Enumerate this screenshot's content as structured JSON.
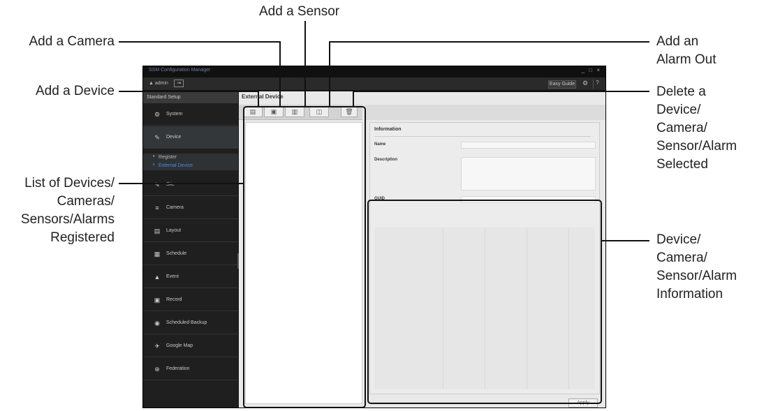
{
  "callouts": {
    "add_sensor": "Add a Sensor",
    "add_camera": "Add a Camera",
    "add_device": "Add a Device",
    "add_alarm_out_1": "Add an",
    "add_alarm_out_2": "Alarm Out",
    "delete_1": "Delete a",
    "delete_2": "Device/",
    "delete_3": "Camera/",
    "delete_4": "Sensor/Alarm",
    "delete_5": "Selected",
    "list_1": "List of Devices/",
    "list_2": "Cameras/",
    "list_3": "Sensors/Alarms",
    "list_4": "Registered",
    "info_1": "Device/",
    "info_2": "Camera/",
    "info_3": "Sensor/Alarm",
    "info_4": "Information"
  },
  "app": {
    "title": "SSM Configuration Manager",
    "window_controls": "_ □ ×",
    "user": "admin",
    "logout_glyph": "⇥",
    "easy_guide": "Easy Guide",
    "settings_icon": "gear-icon",
    "help": "?"
  },
  "sidebar": {
    "header": "Standard Setup",
    "items": [
      {
        "label": "System",
        "icon": "⚙"
      },
      {
        "label": "Device",
        "icon": "✎"
      },
      {
        "label": "Site",
        "icon": "✎"
      },
      {
        "label": "Camera",
        "icon": "≡"
      },
      {
        "label": "Layout",
        "icon": "▤"
      },
      {
        "label": "Schedule",
        "icon": "▦"
      },
      {
        "label": "Event",
        "icon": "▲"
      },
      {
        "label": "Record",
        "icon": "▣"
      },
      {
        "label": "Scheduled Backup",
        "icon": "◉"
      },
      {
        "label": "Google Map",
        "icon": "✈"
      },
      {
        "label": "Federation",
        "icon": "⊕"
      }
    ],
    "sub_items": [
      {
        "label": "Register"
      },
      {
        "label": "External Device"
      }
    ]
  },
  "content": {
    "tab": "External Device",
    "toolbar": [
      {
        "name": "add-device-button",
        "glyph": "▤"
      },
      {
        "name": "add-camera-button",
        "glyph": "▣"
      },
      {
        "name": "add-sensor-button",
        "glyph": "▥"
      },
      {
        "name": "add-alarm-out-button",
        "glyph": "◫"
      },
      {
        "name": "delete-button",
        "glyph": "🗑"
      }
    ],
    "info": {
      "title": "Information",
      "name_label": "Name",
      "description_label": "Description",
      "guid_label": "GUID"
    },
    "apply": "Apply"
  }
}
